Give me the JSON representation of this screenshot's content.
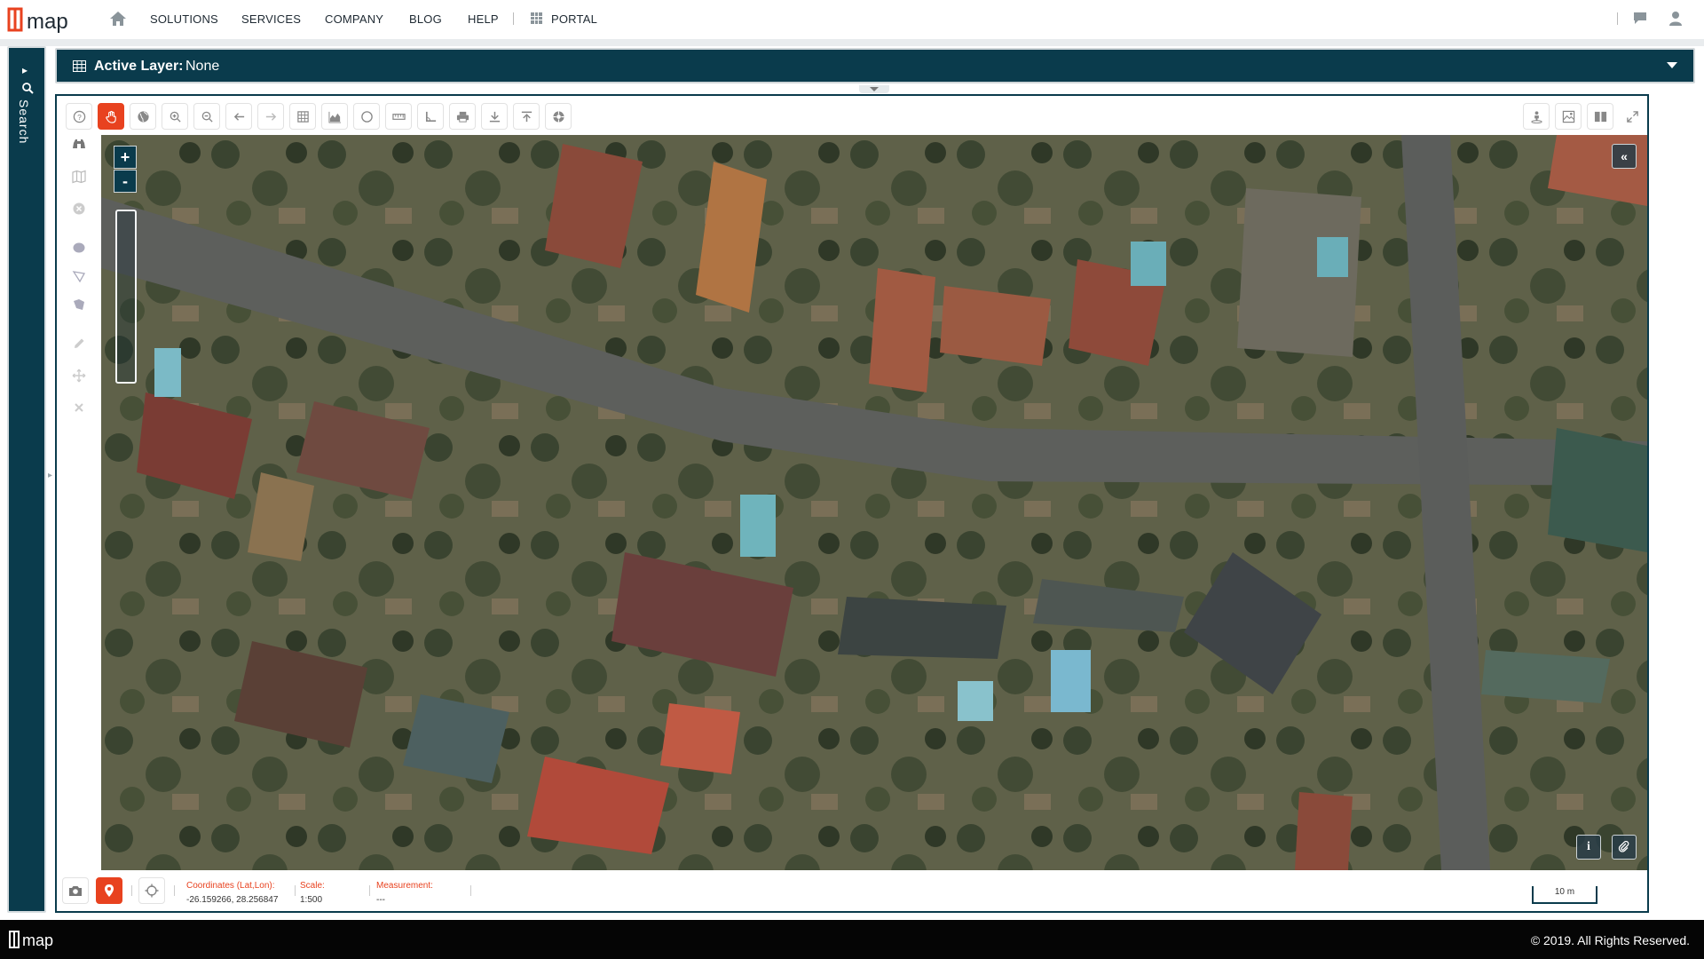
{
  "brand": {
    "logo_text": "map",
    "logo_mark": "1",
    "accent": "#e8421f",
    "dark": "#0a3b4c"
  },
  "nav": {
    "home_icon": "home-icon",
    "links": [
      "SOLUTIONS",
      "SERVICES",
      "COMPANY",
      "BLOG",
      "HELP"
    ],
    "portal": "PORTAL",
    "right_icons": [
      "chat-icon",
      "user-icon"
    ]
  },
  "search_panel": {
    "label": "Search"
  },
  "layer_bar": {
    "label": "Active Layer:",
    "value": "None"
  },
  "toolbar": {
    "tools": [
      "help-icon",
      "pan-hand-icon",
      "globe-icon",
      "zoom-in-icon",
      "zoom-out-icon",
      "back-arrow-icon",
      "forward-arrow-icon",
      "table-icon",
      "elevation-chart-icon",
      "circle-icon",
      "ruler-icon",
      "angle-icon",
      "print-icon",
      "download-icon",
      "upload-icon",
      "settings-icon"
    ],
    "active_tool": "pan-hand-icon",
    "right_tools": [
      "person-pin-icon",
      "map-image-icon",
      "split-view-icon",
      "fullscreen-icon"
    ]
  },
  "side_tools": [
    "binoculars-icon",
    "map-icon",
    "close-circle-icon",
    "ellipse-draw-icon",
    "polyline-draw-icon",
    "polygon-draw-icon",
    "pencil-icon",
    "move-icon",
    "delete-icon"
  ],
  "map": {
    "zoom_in": "+",
    "zoom_out": "-",
    "collapse_label": "«",
    "info_label": "i"
  },
  "map_footer": {
    "coordinates_label": "Coordinates (Lat,Lon):",
    "coordinates_value": "-26.159266, 28.256847",
    "scale_label": "Scale:",
    "scale_value": "1:500",
    "measurement_label": "Measurement:",
    "measurement_value": "---",
    "scalebar_label": "10 m"
  },
  "footer": {
    "copyright": "© 2019. All Rights Reserved."
  }
}
